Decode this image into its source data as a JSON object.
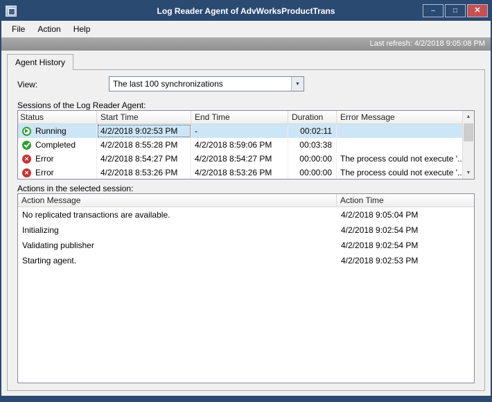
{
  "window": {
    "title": "Log Reader Agent of AdvWorksProductTrans"
  },
  "icons": {
    "minimize": "–",
    "maximize": "□",
    "close": "✕",
    "dropdown": "▼",
    "scroll_up": "▲",
    "scroll_down": "▼"
  },
  "menu": {
    "file": "File",
    "action": "Action",
    "help": "Help"
  },
  "refresh": {
    "text": "Last refresh: 4/2/2018 9:05:08 PM"
  },
  "tab": {
    "label": "Agent History"
  },
  "view": {
    "label": "View:",
    "selected": "The last 100 synchronizations"
  },
  "sessions": {
    "caption": "Sessions of the Log Reader Agent:",
    "columns": [
      "Status",
      "Start Time",
      "End Time",
      "Duration",
      "Error Message"
    ],
    "rows": [
      {
        "icon": "running",
        "status": "Running",
        "start": "4/2/2018 9:02:53 PM",
        "end": "-",
        "duration": "00:02:11",
        "error": ""
      },
      {
        "icon": "completed",
        "status": "Completed",
        "start": "4/2/2018 8:55:28 PM",
        "end": "4/2/2018 8:59:06 PM",
        "duration": "00:03:38",
        "error": ""
      },
      {
        "icon": "error",
        "status": "Error",
        "start": "4/2/2018 8:54:27 PM",
        "end": "4/2/2018 8:54:27 PM",
        "duration": "00:00:00",
        "error": "The process could not execute '..."
      },
      {
        "icon": "error",
        "status": "Error",
        "start": "4/2/2018 8:53:26 PM",
        "end": "4/2/2018 8:53:26 PM",
        "duration": "00:00:00",
        "error": "The process could not execute '..."
      }
    ]
  },
  "actions": {
    "caption": "Actions in the selected session:",
    "columns": [
      "Action Message",
      "Action Time"
    ],
    "rows": [
      {
        "message": "No replicated transactions are available.",
        "time": "4/2/2018 9:05:04 PM"
      },
      {
        "message": "Initializing",
        "time": "4/2/2018 9:02:54 PM"
      },
      {
        "message": "Validating publisher",
        "time": "4/2/2018 9:02:54 PM"
      },
      {
        "message": "Starting agent.",
        "time": "4/2/2018 9:02:53 PM"
      }
    ]
  },
  "colors": {
    "frame": "#2B4A72",
    "close_button": "#C75050",
    "selection": "#CDE6F7",
    "running_green": "#2E9E2E",
    "error_red": "#C53434"
  }
}
